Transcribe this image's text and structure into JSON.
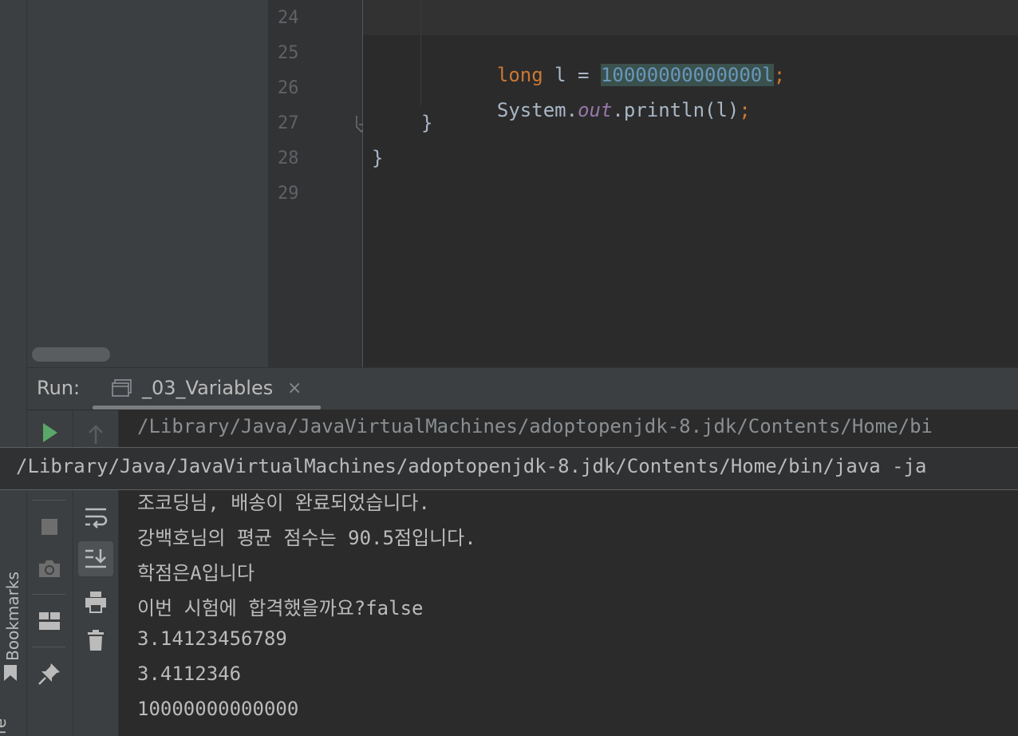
{
  "editor": {
    "line_numbers": [
      "24",
      "25",
      "26",
      "27",
      "28",
      "29"
    ],
    "code": {
      "line25": {
        "kw": "long",
        "ident": " l = ",
        "num": "10000000000000l",
        "semi": ";"
      },
      "line26": {
        "cls": "System.",
        "field": "out",
        "call": ".println(l)",
        "semi": ";"
      },
      "line27": "}",
      "line28": "}"
    }
  },
  "left_strip": {
    "bookmarks_label": "Bookmarks",
    "structure_label": "re"
  },
  "run_panel": {
    "label": "Run:",
    "tab_label": "_03_Variables",
    "tab_close": "×"
  },
  "console": {
    "command_line": "/Library/Java/JavaVirtualMachines/adoptopenjdk-8.jdk/Contents/Home/bi",
    "command_tooltip": "/Library/Java/JavaVirtualMachines/adoptopenjdk-8.jdk/Contents/Home/bin/java -ja",
    "output_lines": [
      "조코딩님, 배송이 완료되었습니다.",
      "강백호님의 평균 점수는 90.5점입니다.",
      "학점은A입니다",
      "이번 시험에 합격했을까요?false",
      "3.14123456789",
      "3.4112346",
      "10000000000000"
    ]
  },
  "colors": {
    "keyword": "#cc7832",
    "number": "#6897bb",
    "field": "#9876aa",
    "run_green": "#59a869"
  },
  "icons": {
    "toolbar_1": [
      "run-icon",
      "stop-icon",
      "camera-icon",
      "layout-icon",
      "pin-icon"
    ],
    "toolbar_2": [
      "up-arrow-icon",
      "soft-wrap-icon",
      "scroll-to-end-icon",
      "print-icon",
      "trash-icon"
    ]
  }
}
